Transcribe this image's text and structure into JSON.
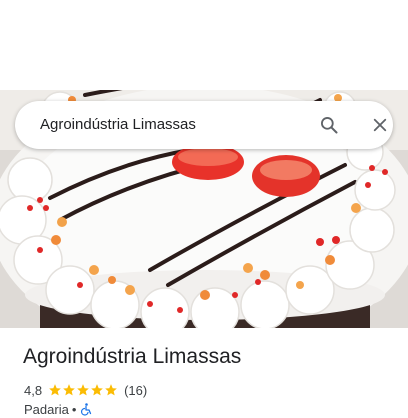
{
  "search": {
    "query": "Agroindústria Limassas"
  },
  "icons": {
    "search": "search-icon",
    "close": "close-icon",
    "accessibility": "wheelchair-icon",
    "star": "star-icon"
  },
  "place": {
    "name": "Agroindústria Limassas",
    "rating": "4,8",
    "stars": 5,
    "reviews": "(16)",
    "category": "Padaria",
    "separator": "•"
  },
  "colors": {
    "star": "#fbbc04",
    "accessibility": "#1a73e8",
    "text": "#202124",
    "secondary": "#3c4043"
  }
}
